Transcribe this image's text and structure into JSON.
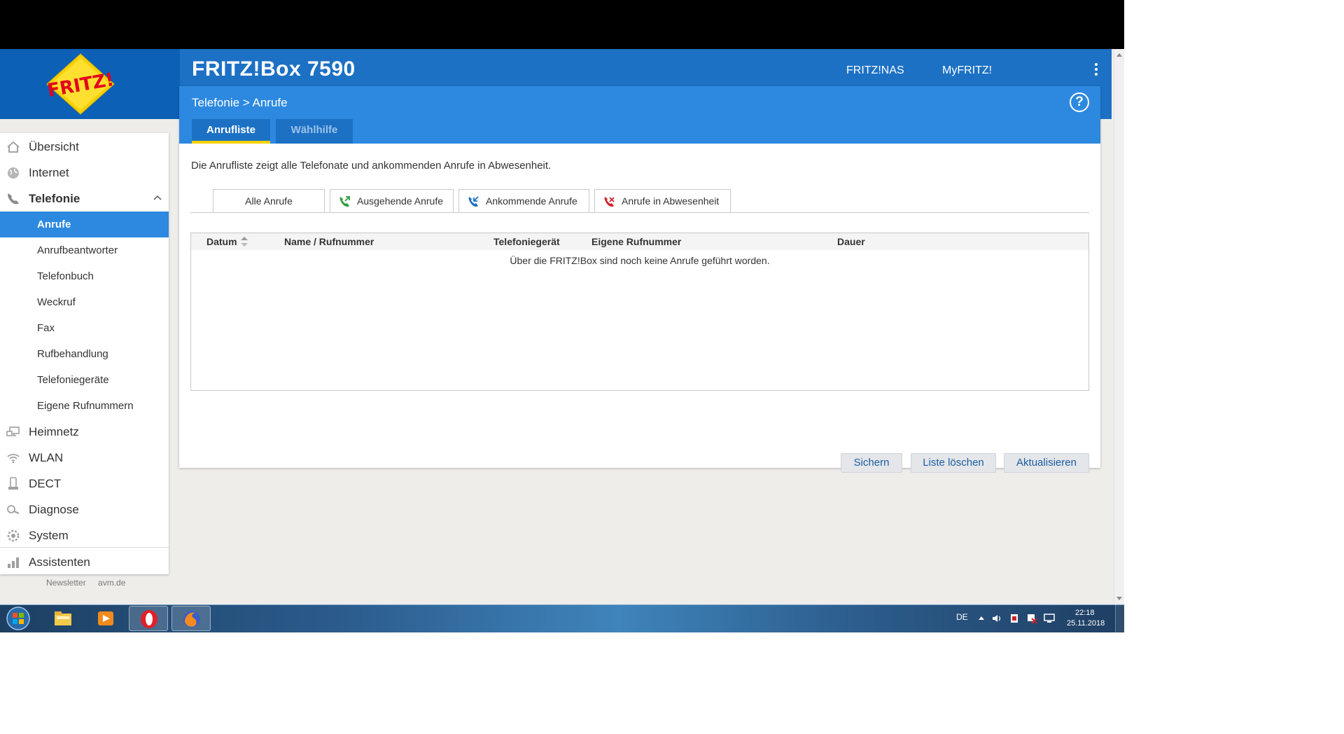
{
  "header": {
    "title": "FRITZ!Box 7590",
    "links": [
      "FRITZ!NAS",
      "MyFRITZ!"
    ],
    "logo_text": "FRITZ!"
  },
  "panel": {
    "breadcrumb": "Telefonie > Anrufe",
    "help_label": "?",
    "tabs": [
      "Anrufliste",
      "Wählhilfe"
    ],
    "intro": "Die Anrufliste zeigt alle Telefonate und ankommenden Anrufe in Abwesenheit.",
    "filter_tabs": [
      "Alle Anrufe",
      "Ausgehende Anrufe",
      "Ankommende Anrufe",
      "Anrufe in Abwesenheit"
    ],
    "table_headers": [
      "Datum",
      "Name / Rufnummer",
      "Telefoniegerät",
      "Eigene Rufnummer",
      "Dauer"
    ],
    "empty_message": "Über die FRITZ!Box sind noch keine Anrufe geführt worden.",
    "buttons": [
      "Sichern",
      "Liste löschen",
      "Aktualisieren"
    ]
  },
  "sidebar": {
    "items": [
      {
        "label": "Übersicht",
        "icon": "home-icon"
      },
      {
        "label": "Internet",
        "icon": "globe-icon"
      },
      {
        "label": "Telefonie",
        "icon": "phone-icon"
      },
      {
        "label": "Heimnetz",
        "icon": "network-icon"
      },
      {
        "label": "WLAN",
        "icon": "wifi-icon"
      },
      {
        "label": "DECT",
        "icon": "dect-icon"
      },
      {
        "label": "Diagnose",
        "icon": "diagnose-icon"
      },
      {
        "label": "System",
        "icon": "system-icon"
      },
      {
        "label": "Assistenten",
        "icon": "assistant-icon"
      }
    ],
    "telefonie_sub": [
      "Anrufe",
      "Anrufbeantworter",
      "Telefonbuch",
      "Weckruf",
      "Fax",
      "Rufbehandlung",
      "Telefoniegeräte",
      "Eigene Rufnummern"
    ],
    "active_sub": "Anrufe"
  },
  "footer": {
    "links": [
      "Newsletter",
      "avm.de"
    ]
  },
  "taskbar": {
    "lang": "DE",
    "time": "22:18",
    "date": "25.11.2018"
  },
  "colors": {
    "brand_blue": "#1c71c4",
    "accent_blue": "#2d89df",
    "tab_underline": "#f7d000"
  }
}
